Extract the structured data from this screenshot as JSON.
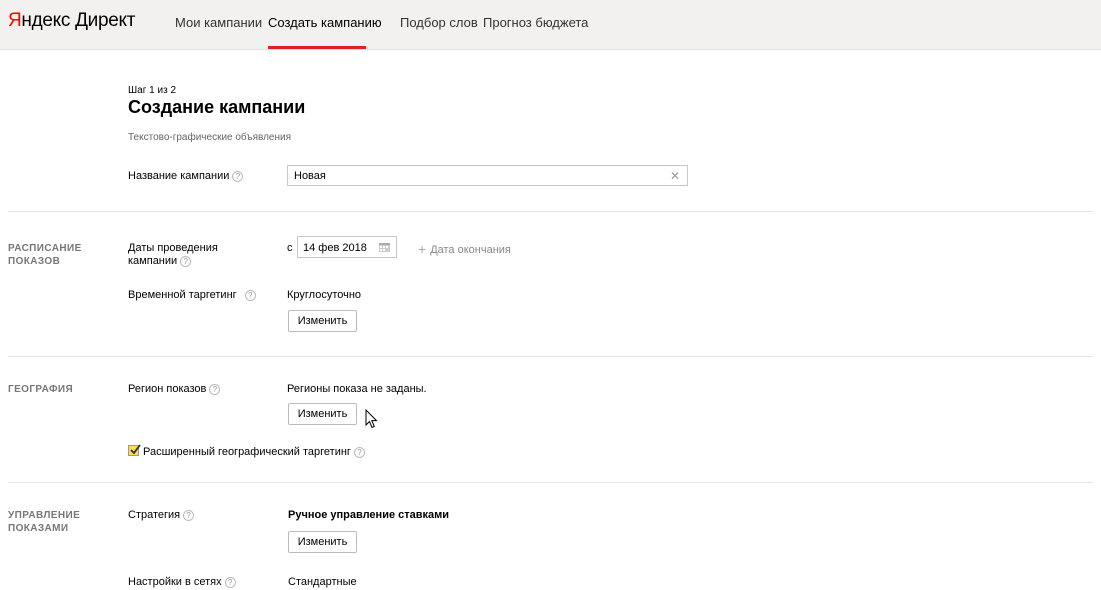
{
  "header": {
    "logo_brand": "Яндекс",
    "logo_brand_first": "Я",
    "logo_brand_rest": "ндекс",
    "logo_product": "Директ",
    "nav": [
      {
        "label": "Мои кампании"
      },
      {
        "label": "Создать кампанию",
        "active": true
      },
      {
        "label": "Подбор слов"
      },
      {
        "label": "Прогноз бюджета"
      }
    ]
  },
  "page": {
    "step": "Шаг 1 из 2",
    "title": "Создание кампании",
    "subtitle": "Текстово-графические объявления"
  },
  "campaign_name": {
    "label": "Название кампании",
    "value": "Новая",
    "clear_icon": "close-icon"
  },
  "schedule": {
    "section_title_line1": "РАСПИСАНИЕ",
    "section_title_line2": "ПОКАЗОВ",
    "dates_label_line1": "Даты проведения",
    "dates_label_line2": "кампании",
    "date_prefix": "с",
    "start_date": "14 фев 2018",
    "add_end_date": "Дата окончания",
    "time_targeting_label": "Временной таргетинг",
    "time_targeting_value": "Круглосуточно",
    "change_button": "Изменить"
  },
  "geography": {
    "section_title": "ГЕОГРАФИЯ",
    "region_label": "Регион показов",
    "region_value": "Регионы показа не заданы.",
    "change_button": "Изменить",
    "extended_geo_label": "Расширенный географический таргетинг",
    "extended_geo_checked": true
  },
  "management": {
    "section_title_line1": "УПРАВЛЕНИЕ",
    "section_title_line2": "ПОКАЗАМИ",
    "strategy_label": "Стратегия",
    "strategy_value": "Ручное управление ставками",
    "change_button": "Изменить",
    "network_settings_label": "Настройки в сетях",
    "network_settings_value": "Стандартные"
  },
  "colors": {
    "accent_red": "#e31e24",
    "checkbox_yellow": "#ffdb4d",
    "header_bg": "#f2f1f0"
  }
}
